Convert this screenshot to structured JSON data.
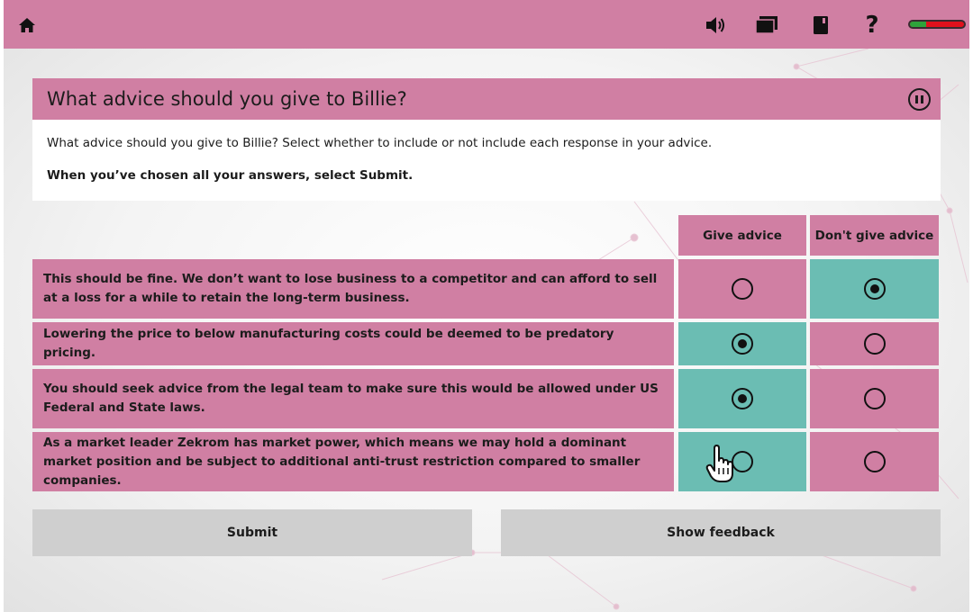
{
  "topbar": {
    "icons": [
      "home-icon",
      "speaker-icon",
      "folders-icon",
      "book-icon",
      "help-icon"
    ],
    "help_glyph": "?",
    "battery_level": 0.3
  },
  "question": {
    "title": "What advice should you give to Billie?",
    "instruction": "What advice should you give to Billie? Select whether to include or not include each response in your advice.",
    "instruction_bold": "When you’ve chosen all your answers, select Submit."
  },
  "columns": [
    "Give advice",
    "Don't give advice"
  ],
  "rows": [
    {
      "text": "This should be fine. We don’t want to lose business to a competitor and can afford to sell at a loss for a while to retain the long-term business.",
      "give_selected": false,
      "dont_selected": true,
      "give_bg": "pink",
      "dont_bg": "teal"
    },
    {
      "text": "Lowering the price to below manufacturing costs could be deemed to be predatory pricing.",
      "give_selected": true,
      "dont_selected": false,
      "give_bg": "teal",
      "dont_bg": "pink"
    },
    {
      "text": "You should seek advice from the legal team to make sure this would be allowed under US Federal and State laws.",
      "give_selected": true,
      "dont_selected": false,
      "give_bg": "teal",
      "dont_bg": "pink"
    },
    {
      "text": "As a market leader Zekrom has market power, which means we may hold a dominant market position and be subject to additional anti-trust restriction compared to smaller companies.",
      "give_selected": false,
      "dont_selected": false,
      "give_bg": "teal",
      "dont_bg": "pink"
    }
  ],
  "buttons": {
    "submit": "Submit",
    "feedback": "Show feedback"
  },
  "colors": {
    "accent_pink": "#d07fa3",
    "selected_teal": "#6bbdb3",
    "button_gray": "#cfcfcf"
  }
}
